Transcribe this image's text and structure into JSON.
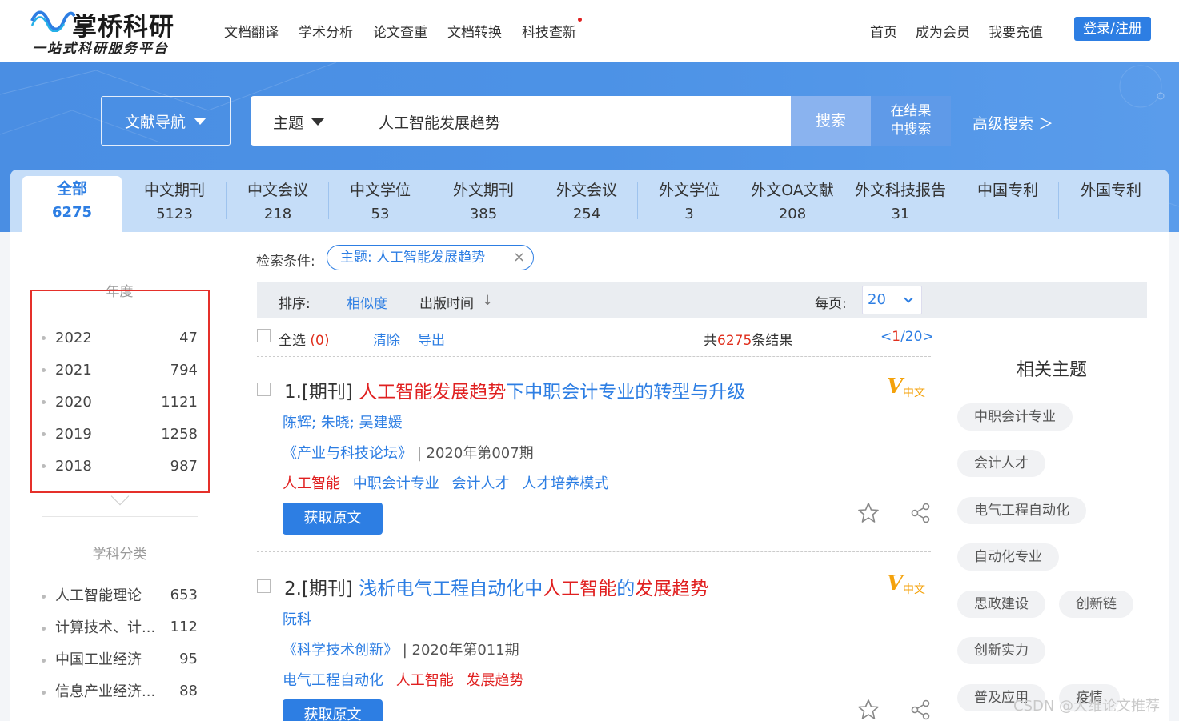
{
  "logo": {
    "name": "掌桥科研",
    "slogan": "一站式科研服务平台"
  },
  "top_nav": [
    "文档翻译",
    "学术分析",
    "论文查重",
    "文档转换",
    "科技查新"
  ],
  "right_nav": [
    "首页",
    "成为会员",
    "我要充值"
  ],
  "login_label": "登录/注册",
  "search": {
    "nav_label": "文献导航",
    "type_label": "主题",
    "query": "人工智能发展趋势",
    "search_label": "搜索",
    "in_result_line1": "在结果",
    "in_result_line2": "中搜索",
    "advanced_label": "高级搜索 ＞"
  },
  "tabs": [
    {
      "label": "全部",
      "count": "6275"
    },
    {
      "label": "中文期刊",
      "count": "5123"
    },
    {
      "label": "中文会议",
      "count": "218"
    },
    {
      "label": "中文学位",
      "count": "53"
    },
    {
      "label": "外文期刊",
      "count": "385"
    },
    {
      "label": "外文会议",
      "count": "254"
    },
    {
      "label": "外文学位",
      "count": "3"
    },
    {
      "label": "外文OA文献",
      "count": "208"
    },
    {
      "label": "外文科技报告",
      "count": "31"
    },
    {
      "label": "中国专利",
      "count": ""
    },
    {
      "label": "外国专利",
      "count": ""
    }
  ],
  "sidebar": {
    "year_title": "年度",
    "years": [
      {
        "name": "2022",
        "count": "47"
      },
      {
        "name": "2021",
        "count": "794"
      },
      {
        "name": "2020",
        "count": "1121"
      },
      {
        "name": "2019",
        "count": "1258"
      },
      {
        "name": "2018",
        "count": "987"
      }
    ],
    "subject_title": "学科分类",
    "subjects": [
      {
        "name": "人工智能理论",
        "count": "653"
      },
      {
        "name": "计算技术、计...",
        "count": "112"
      },
      {
        "name": "中国工业经济",
        "count": "95"
      },
      {
        "name": "信息产业经济...",
        "count": "88"
      }
    ]
  },
  "conditions": {
    "label": "检索条件:",
    "tag": "主题: 人工智能发展趋势"
  },
  "sort": {
    "label": "排序:",
    "relevance": "相似度",
    "pub_time": "出版时间",
    "per_page_label": "每页:",
    "per_page_value": "20"
  },
  "selection": {
    "select_all": "全选",
    "selected_count": "(0)",
    "clear": "清除",
    "export": "导出",
    "total_prefix": "共",
    "total_num": "6275",
    "total_suffix": "条结果",
    "page_prefix": "<",
    "page_current": "1",
    "page_suffix": "/20>"
  },
  "results": [
    {
      "prefix": "1.[期刊] ",
      "title_parts": [
        {
          "text": "人工智能发展趋势",
          "hl": true
        },
        {
          "text": "下中职会计专业的转型与升级",
          "hl": false
        }
      ],
      "badge_v": "V",
      "badge_zh": "中文",
      "authors": "陈辉; 朱晓; 吴建媛",
      "journal": "《产业与科技论坛》",
      "issue": " | 2020年第007期",
      "keywords": [
        {
          "text": "人工智能",
          "hl": true
        },
        {
          "text": "中职会计专业",
          "hl": false
        },
        {
          "text": "会计人才",
          "hl": false
        },
        {
          "text": "人才培养模式",
          "hl": false
        }
      ],
      "get_label": "获取原文"
    },
    {
      "prefix": "2.[期刊] ",
      "title_parts": [
        {
          "text": "浅析电气工程自动化中",
          "hl": false
        },
        {
          "text": "人工智能",
          "hl": true
        },
        {
          "text": "的",
          "hl": false
        },
        {
          "text": "发展趋势",
          "hl": true
        }
      ],
      "badge_v": "V",
      "badge_zh": "中文",
      "authors": "阮科",
      "journal": "《科学技术创新》",
      "issue": " | 2020年第011期",
      "keywords": [
        {
          "text": "电气工程自动化",
          "hl": false
        },
        {
          "text": "人工智能",
          "hl": true
        },
        {
          "text": "发展趋势",
          "hl": true
        }
      ],
      "get_label": "获取原文"
    }
  ],
  "related": {
    "title": "相关主题",
    "tags": [
      "中职会计专业",
      "会计人才",
      "电气工程自动化",
      "自动化专业",
      "思政建设",
      "创新链",
      "创新实力",
      "普及应用",
      "疫情"
    ]
  },
  "watermark": "CSDN @大维论文推荐",
  "colors": {
    "primary": "#2d7ee3",
    "highlight": "#e02020",
    "badge": "#f4a20b"
  }
}
